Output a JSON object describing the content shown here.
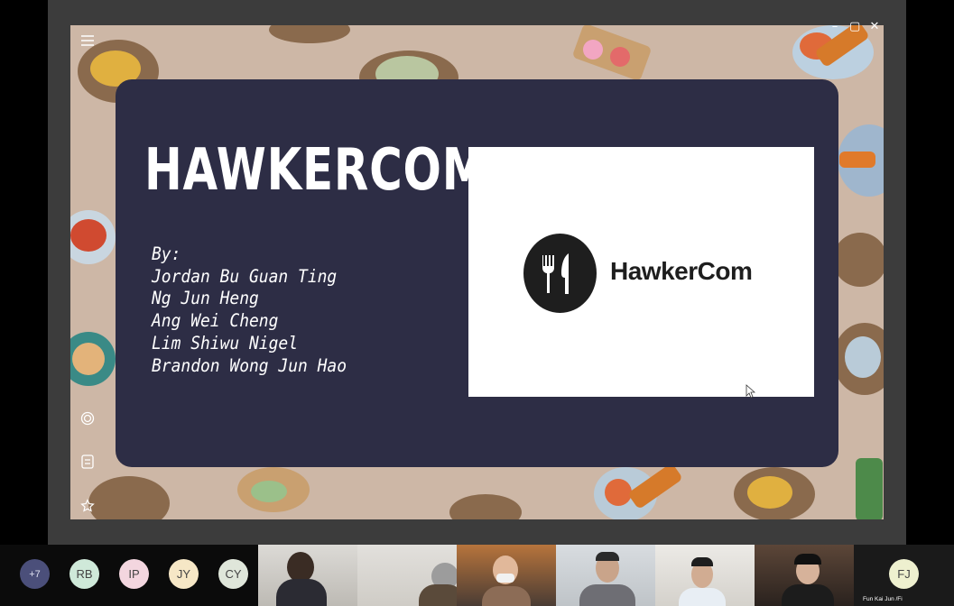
{
  "slide": {
    "title": "HAWKERCOM",
    "authors_heading": "By:",
    "authors": [
      "Jordan Bu Guan Ting",
      "Ng Jun Heng",
      "Ang Wei Cheng",
      "Lim Shiwu Nigel",
      "Brandon Wong Jun Hao"
    ],
    "logo_text": "HawkerCom"
  },
  "window_controls": {
    "minimize": "–",
    "maximize": "▢",
    "close": "✕"
  },
  "side_icons": [
    "menu-icon",
    "target-icon",
    "notes-icon",
    "star-icon"
  ],
  "participants": {
    "overflow": "+7",
    "avatars": [
      {
        "initials": "RB",
        "color": "#cfe9d9"
      },
      {
        "initials": "IP",
        "color": "#f3d6df"
      },
      {
        "initials": "JY",
        "color": "#f6e7c6"
      },
      {
        "initials": "CY",
        "color": "#dfe6da"
      }
    ],
    "last": {
      "initials": "FJ",
      "name": "Fun Kai Jun /Fi",
      "color": "#eef0cf"
    }
  },
  "colors": {
    "card": "#2d2d45",
    "background": "#cdb7a6"
  }
}
